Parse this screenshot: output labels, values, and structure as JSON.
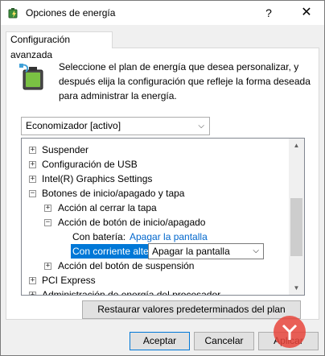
{
  "window": {
    "title": "Opciones de energía",
    "help_glyph": "?",
    "close_glyph": "✕"
  },
  "tab": {
    "label": "Configuración avanzada"
  },
  "description": "Seleccione el plan de energía que desea personalizar, y después elija la configuración que refleje la forma deseada para administrar la energía.",
  "plan_select": {
    "value": "Economizador [activo]",
    "arrow": "⌵"
  },
  "tree": {
    "items": [
      {
        "label": "Suspender",
        "expander": "+"
      },
      {
        "label": "Configuración de USB",
        "expander": "+"
      },
      {
        "label": "Intel(R) Graphics Settings",
        "expander": "+"
      },
      {
        "label": "Botones de inicio/apagado y tapa",
        "expander": "−"
      },
      {
        "label": "Acción al cerrar la tapa",
        "expander": "+"
      },
      {
        "label": "Acción de botón de inicio/apagado",
        "expander": "−"
      },
      {
        "label": "Con batería:",
        "value": "Apagar la pantalla"
      },
      {
        "label": "Con corriente alterna:",
        "value": "Apagar la pantalla"
      },
      {
        "label": "Acción del botón de suspensión",
        "expander": "+"
      },
      {
        "label": "PCI Express",
        "expander": "+"
      },
      {
        "label": "Administración de energía del procesador",
        "expander": "+"
      }
    ]
  },
  "scrollbar": {
    "up_glyph": "▲",
    "down_glyph": "▼"
  },
  "buttons": {
    "restore": "Restaurar valores predeterminados del plan",
    "accept": "Aceptar",
    "cancel": "Cancelar",
    "apply": "Aplicar"
  },
  "colors": {
    "accent": "#0078d7",
    "link": "#0066cc"
  }
}
